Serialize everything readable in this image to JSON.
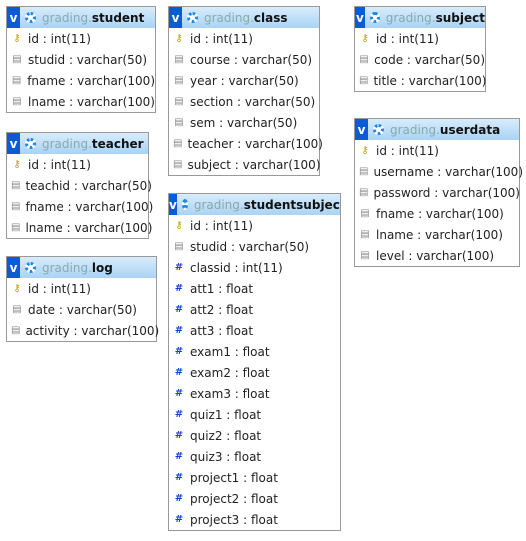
{
  "tables": [
    {
      "db": "grading.",
      "name": "student",
      "columns": [
        {
          "text": "id : int(11)",
          "icon": "key"
        },
        {
          "text": "studid : varchar(50)",
          "icon": "col"
        },
        {
          "text": "fname : varchar(100)",
          "icon": "col"
        },
        {
          "text": "lname : varchar(100)",
          "icon": "col"
        }
      ]
    },
    {
      "db": "grading.",
      "name": "teacher",
      "columns": [
        {
          "text": "id : int(11)",
          "icon": "key"
        },
        {
          "text": "teachid : varchar(50)",
          "icon": "col"
        },
        {
          "text": "fname : varchar(100)",
          "icon": "col"
        },
        {
          "text": "lname : varchar(100)",
          "icon": "col"
        }
      ]
    },
    {
      "db": "grading.",
      "name": "log",
      "columns": [
        {
          "text": "id : int(11)",
          "icon": "key"
        },
        {
          "text": "date : varchar(50)",
          "icon": "col"
        },
        {
          "text": "activity : varchar(100)",
          "icon": "col"
        }
      ]
    },
    {
      "db": "grading.",
      "name": "class",
      "columns": [
        {
          "text": "id : int(11)",
          "icon": "key"
        },
        {
          "text": "course : varchar(50)",
          "icon": "col"
        },
        {
          "text": "year : varchar(50)",
          "icon": "col"
        },
        {
          "text": "section : varchar(50)",
          "icon": "col"
        },
        {
          "text": "sem : varchar(50)",
          "icon": "col"
        },
        {
          "text": "teacher : varchar(100)",
          "icon": "col"
        },
        {
          "text": "subject : varchar(100)",
          "icon": "col"
        }
      ]
    },
    {
      "db": "grading.",
      "name": "studentsubject",
      "columns": [
        {
          "text": "id : int(11)",
          "icon": "key"
        },
        {
          "text": "studid : varchar(50)",
          "icon": "col"
        },
        {
          "text": "classid : int(11)",
          "icon": "num"
        },
        {
          "text": "att1 : float",
          "icon": "num"
        },
        {
          "text": "att2 : float",
          "icon": "num"
        },
        {
          "text": "att3 : float",
          "icon": "num"
        },
        {
          "text": "exam1 : float",
          "icon": "num"
        },
        {
          "text": "exam2 : float",
          "icon": "num"
        },
        {
          "text": "exam3 : float",
          "icon": "num"
        },
        {
          "text": "quiz1 : float",
          "icon": "num"
        },
        {
          "text": "quiz2 : float",
          "icon": "num"
        },
        {
          "text": "quiz3 : float",
          "icon": "num"
        },
        {
          "text": "project1 : float",
          "icon": "num"
        },
        {
          "text": "project2 : float",
          "icon": "num"
        },
        {
          "text": "project3 : float",
          "icon": "num"
        }
      ]
    },
    {
      "db": "grading.",
      "name": "subject",
      "columns": [
        {
          "text": "id : int(11)",
          "icon": "key"
        },
        {
          "text": "code : varchar(50)",
          "icon": "col"
        },
        {
          "text": "title : varchar(100)",
          "icon": "col"
        }
      ]
    },
    {
      "db": "grading.",
      "name": "userdata",
      "columns": [
        {
          "text": "id : int(11)",
          "icon": "key"
        },
        {
          "text": "username : varchar(100)",
          "icon": "col"
        },
        {
          "text": "password : varchar(100)",
          "icon": "col"
        },
        {
          "text": "fname : varchar(100)",
          "icon": "col"
        },
        {
          "text": "lname : varchar(100)",
          "icon": "col"
        },
        {
          "text": "level : varchar(100)",
          "icon": "col"
        }
      ]
    }
  ],
  "icons": {
    "key": "key-icon",
    "col": "column-icon",
    "num": "numeric-column-icon",
    "toggle": "v",
    "options": "gear-icon"
  }
}
